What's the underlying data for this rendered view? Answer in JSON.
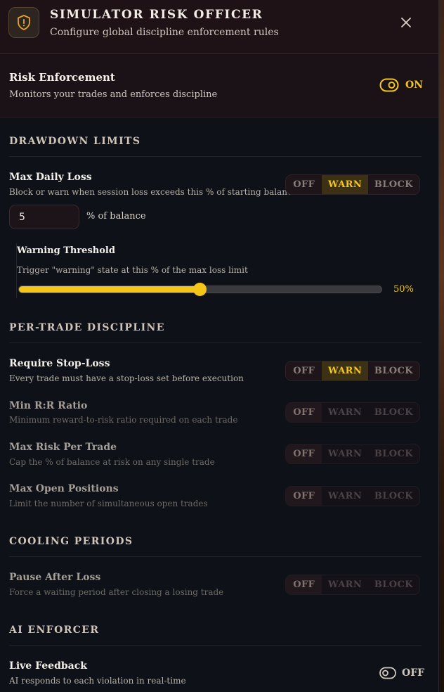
{
  "header": {
    "icon": "shield-alert-icon",
    "title": "SIMULATOR RISK OFFICER",
    "subtitle": "Configure global discipline enforcement rules",
    "close_icon": "close-icon"
  },
  "enforcement": {
    "title": "Risk Enforcement",
    "subtitle": "Monitors your trades and enforces discipline",
    "state": "ON",
    "accent": "#f5c518"
  },
  "sections": {
    "drawdown": "DRAWDOWN LIMITS",
    "per_trade": "PER-TRADE DISCIPLINE",
    "cooling": "COOLING PERIODS",
    "ai": "AI ENFORCER"
  },
  "segment_labels": {
    "off": "OFF",
    "warn": "WARN",
    "block": "BLOCK"
  },
  "rules": {
    "max_daily_loss": {
      "title": "Max Daily Loss",
      "subtitle": "Block or warn when session loss exceeds this % of starting balance",
      "mode": "WARN",
      "value": "5",
      "unit": "% of balance"
    },
    "warning_threshold": {
      "title": "Warning Threshold",
      "subtitle": "Trigger \"warning\" state at this % of the max loss limit",
      "value": 50,
      "label": "50%"
    },
    "stop_loss": {
      "title": "Require Stop-Loss",
      "subtitle": "Every trade must have a stop-loss set before execution",
      "mode": "WARN"
    },
    "min_rr": {
      "title": "Min R:R Ratio",
      "subtitle": "Minimum reward-to-risk ratio required on each trade",
      "mode": "OFF"
    },
    "max_risk": {
      "title": "Max Risk Per Trade",
      "subtitle": "Cap the % of balance at risk on any single trade",
      "mode": "OFF"
    },
    "max_open": {
      "title": "Max Open Positions",
      "subtitle": "Limit the number of simultaneous open trades",
      "mode": "OFF"
    },
    "pause_after_loss": {
      "title": "Pause After Loss",
      "subtitle": "Force a waiting period after closing a losing trade",
      "mode": "OFF"
    },
    "live_feedback": {
      "title": "Live Feedback",
      "subtitle": "AI responds to each violation in real-time",
      "state": "OFF"
    }
  }
}
